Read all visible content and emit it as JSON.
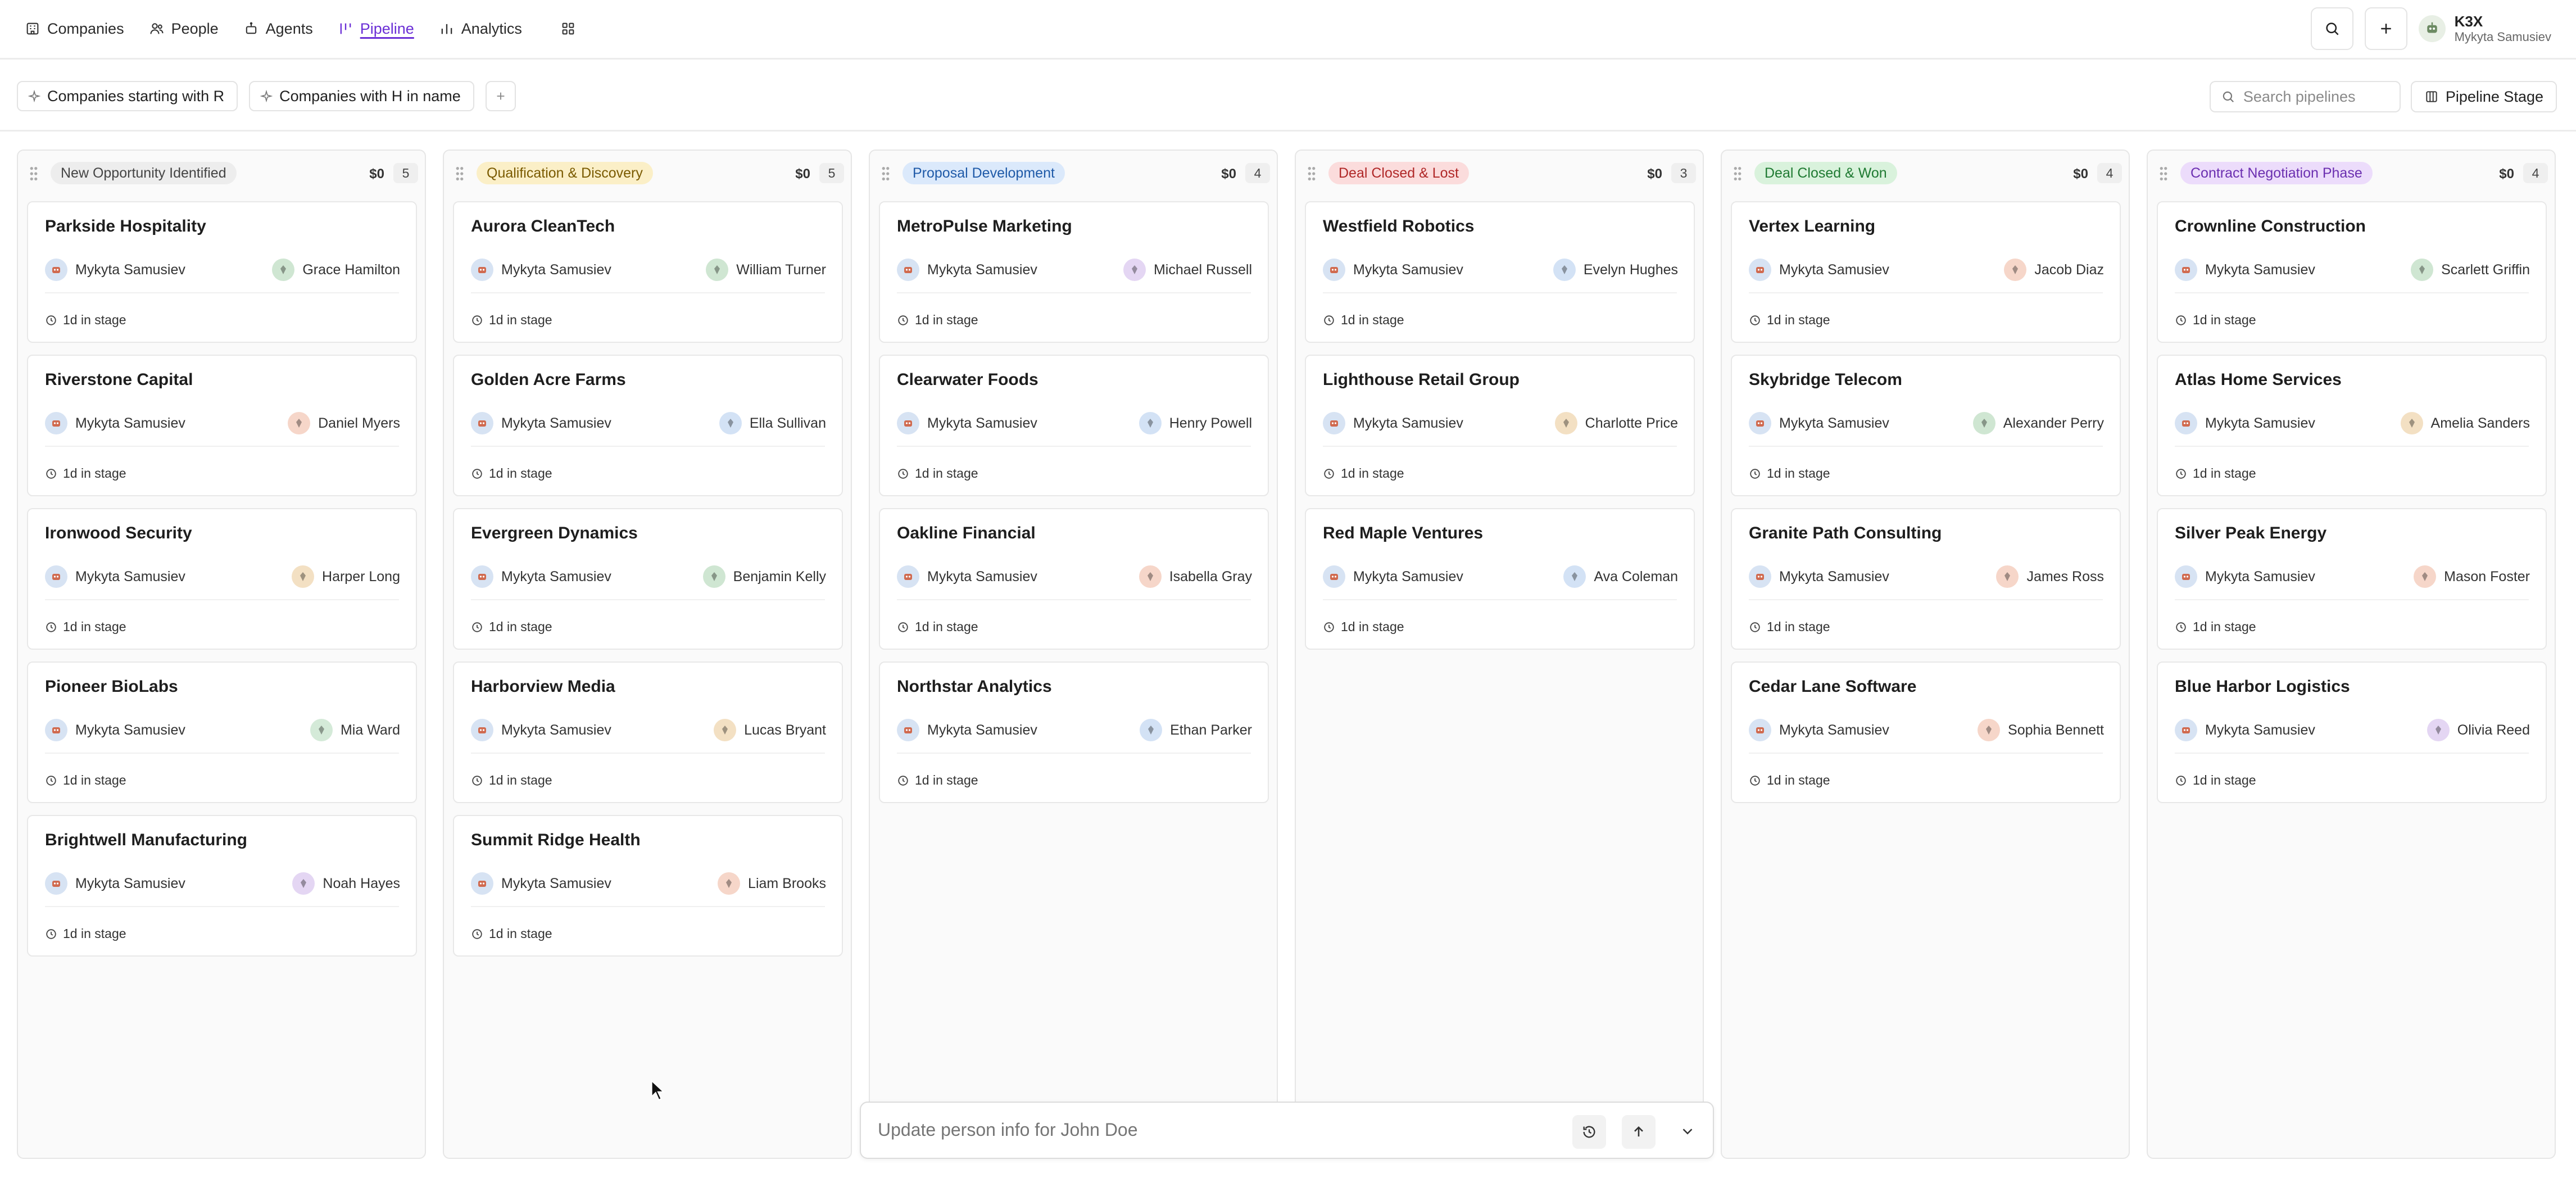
{
  "nav": {
    "items": [
      {
        "label": "Companies",
        "icon": "building-icon",
        "active": false
      },
      {
        "label": "People",
        "icon": "people-icon",
        "active": false
      },
      {
        "label": "Agents",
        "icon": "agent-icon",
        "active": false
      },
      {
        "label": "Pipeline",
        "icon": "pipeline-icon",
        "active": true
      },
      {
        "label": "Analytics",
        "icon": "analytics-icon",
        "active": false
      }
    ],
    "accent": "#6b2fd6"
  },
  "user": {
    "name": "K3X",
    "subtitle": "Mykyta Samusiev"
  },
  "filters": {
    "chips": [
      "Companies starting with R",
      "Companies with H in name"
    ],
    "search_placeholder": "Search pipelines",
    "group_by_label": "Pipeline Stage"
  },
  "columns": [
    {
      "stage": "New Opportunity Identified",
      "amount": "$0",
      "count": "5",
      "pill_bg": "#ededed",
      "pill_fg": "#444444",
      "cards": [
        {
          "title": "Parkside Hospitality",
          "owner": "Mykyta Samusiev",
          "contact": "Grace Hamilton",
          "contact_color": "#cfe6d2",
          "time": "1d in stage"
        },
        {
          "title": "Riverstone Capital",
          "owner": "Mykyta Samusiev",
          "contact": "Daniel Myers",
          "contact_color": "#f6d6c9",
          "time": "1d in stage"
        },
        {
          "title": "Ironwood Security",
          "owner": "Mykyta Samusiev",
          "contact": "Harper Long",
          "contact_color": "#f3e0c3",
          "time": "1d in stage"
        },
        {
          "title": "Pioneer BioLabs",
          "owner": "Mykyta Samusiev",
          "contact": "Mia Ward",
          "contact_color": "#d4ead8",
          "time": "1d in stage"
        },
        {
          "title": "Brightwell Manufacturing",
          "owner": "Mykyta Samusiev",
          "contact": "Noah Hayes",
          "contact_color": "#e4d6f3",
          "time": "1d in stage"
        }
      ]
    },
    {
      "stage": "Qualification & Discovery",
      "amount": "$0",
      "count": "5",
      "pill_bg": "#fbefc7",
      "pill_fg": "#7a5a00",
      "cards": [
        {
          "title": "Aurora CleanTech",
          "owner": "Mykyta Samusiev",
          "contact": "William Turner",
          "contact_color": "#cfe6d2",
          "time": "1d in stage"
        },
        {
          "title": "Golden Acre Farms",
          "owner": "Mykyta Samusiev",
          "contact": "Ella Sullivan",
          "contact_color": "#d3e2f5",
          "time": "1d in stage"
        },
        {
          "title": "Evergreen Dynamics",
          "owner": "Mykyta Samusiev",
          "contact": "Benjamin Kelly",
          "contact_color": "#cfe6d2",
          "time": "1d in stage"
        },
        {
          "title": "Harborview Media",
          "owner": "Mykyta Samusiev",
          "contact": "Lucas Bryant",
          "contact_color": "#f3e0c3",
          "time": "1d in stage"
        },
        {
          "title": "Summit Ridge Health",
          "owner": "Mykyta Samusiev",
          "contact": "Liam Brooks",
          "contact_color": "#f6d6c9",
          "time": "1d in stage"
        }
      ]
    },
    {
      "stage": "Proposal Development",
      "amount": "$0",
      "count": "4",
      "pill_bg": "#dbe9fb",
      "pill_fg": "#1f5aa8",
      "cards": [
        {
          "title": "MetroPulse Marketing",
          "owner": "Mykyta Samusiev",
          "contact": "Michael Russell",
          "contact_color": "#e4d6f3",
          "time": "1d in stage"
        },
        {
          "title": "Clearwater Foods",
          "owner": "Mykyta Samusiev",
          "contact": "Henry Powell",
          "contact_color": "#d3e2f5",
          "time": "1d in stage"
        },
        {
          "title": "Oakline Financial",
          "owner": "Mykyta Samusiev",
          "contact": "Isabella Gray",
          "contact_color": "#f6d6c9",
          "time": "1d in stage"
        },
        {
          "title": "Northstar Analytics",
          "owner": "Mykyta Samusiev",
          "contact": "Ethan Parker",
          "contact_color": "#d3e2f5",
          "time": "1d in stage"
        }
      ]
    },
    {
      "stage": "Deal Closed & Lost",
      "amount": "$0",
      "count": "3",
      "pill_bg": "#fbdcdc",
      "pill_fg": "#b02828",
      "cards": [
        {
          "title": "Westfield Robotics",
          "owner": "Mykyta Samusiev",
          "contact": "Evelyn Hughes",
          "contact_color": "#d3e2f5",
          "time": "1d in stage"
        },
        {
          "title": "Lighthouse Retail Group",
          "owner": "Mykyta Samusiev",
          "contact": "Charlotte Price",
          "contact_color": "#f3e0c3",
          "time": "1d in stage"
        },
        {
          "title": "Red Maple Ventures",
          "owner": "Mykyta Samusiev",
          "contact": "Ava Coleman",
          "contact_color": "#d3e2f5",
          "time": "1d in stage"
        }
      ]
    },
    {
      "stage": "Deal Closed & Won",
      "amount": "$0",
      "count": "4",
      "pill_bg": "#d9f2dc",
      "pill_fg": "#1f7a32",
      "cards": [
        {
          "title": "Vertex Learning",
          "owner": "Mykyta Samusiev",
          "contact": "Jacob Diaz",
          "contact_color": "#f6d6c9",
          "time": "1d in stage"
        },
        {
          "title": "Skybridge Telecom",
          "owner": "Mykyta Samusiev",
          "contact": "Alexander Perry",
          "contact_color": "#cfe6d2",
          "time": "1d in stage"
        },
        {
          "title": "Granite Path Consulting",
          "owner": "Mykyta Samusiev",
          "contact": "James Ross",
          "contact_color": "#f6d6c9",
          "time": "1d in stage"
        },
        {
          "title": "Cedar Lane Software",
          "owner": "Mykyta Samusiev",
          "contact": "Sophia Bennett",
          "contact_color": "#f6d6c9",
          "time": "1d in stage"
        }
      ]
    },
    {
      "stage": "Contract Negotiation Phase",
      "amount": "$0",
      "count": "4",
      "pill_bg": "#ecdcfb",
      "pill_fg": "#6b2fb0",
      "cards": [
        {
          "title": "Crownline Construction",
          "owner": "Mykyta Samusiev",
          "contact": "Scarlett Griffin",
          "contact_color": "#cfe6d2",
          "time": "1d in stage"
        },
        {
          "title": "Atlas Home Services",
          "owner": "Mykyta Samusiev",
          "contact": "Amelia Sanders",
          "contact_color": "#f3e0c3",
          "time": "1d in stage"
        },
        {
          "title": "Silver Peak Energy",
          "owner": "Mykyta Samusiev",
          "contact": "Mason Foster",
          "contact_color": "#f6d6c9",
          "time": "1d in stage"
        },
        {
          "title": "Blue Harbor Logistics",
          "owner": "Mykyta Samusiev",
          "contact": "Olivia Reed",
          "contact_color": "#e4d6f3",
          "time": "1d in stage"
        }
      ]
    }
  ],
  "chat": {
    "placeholder": "Update person info for John Doe"
  }
}
